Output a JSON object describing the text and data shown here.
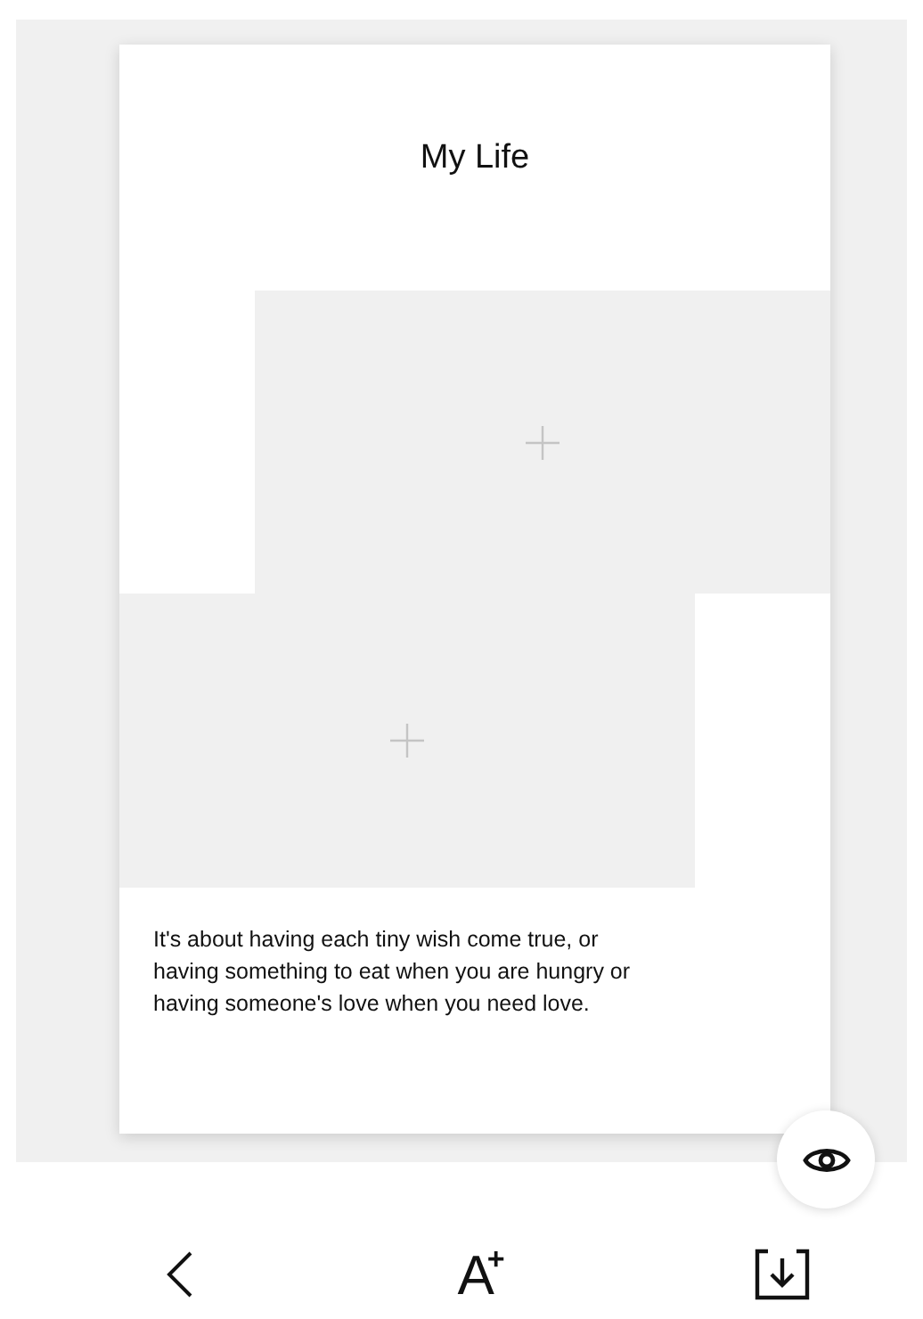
{
  "card": {
    "title": "My Life",
    "photo_slots": [
      {
        "kind": "right"
      },
      {
        "kind": "left"
      }
    ],
    "caption": "It's about having each tiny wish come true, or having something to eat when you are hungry or having someone's love when you need love."
  },
  "toolbar": {
    "font_button": {
      "glyph": "A",
      "mark": "+"
    }
  }
}
